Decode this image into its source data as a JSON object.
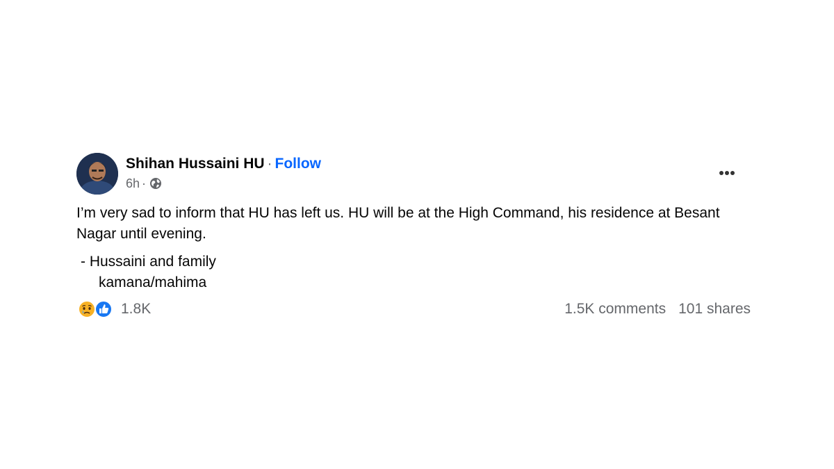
{
  "post": {
    "author": "Shihan Hussaini HU",
    "separator": "·",
    "follow_label": "Follow",
    "time": "6h",
    "time_separator": "·",
    "audience_icon": "globe-icon",
    "more_icon": "more-options-icon",
    "text": "I’m very sad to inform that HU has left us. HU will be at the High Command, his residence at Besant Nagar until evening.",
    "signature_line_1": "- Hussaini and family",
    "signature_line_2": "kamana/mahima"
  },
  "reactions": {
    "icons": [
      "sad-reaction-icon",
      "like-reaction-icon"
    ],
    "count": "1.8K"
  },
  "engagement": {
    "comments": "1.5K comments",
    "shares": "101 shares"
  },
  "colors": {
    "follow": "#0866ff",
    "secondary_text": "#65676b",
    "primary_text": "#050505",
    "like_blue": "#1877f2",
    "sad_yellow": "#f7b125"
  }
}
